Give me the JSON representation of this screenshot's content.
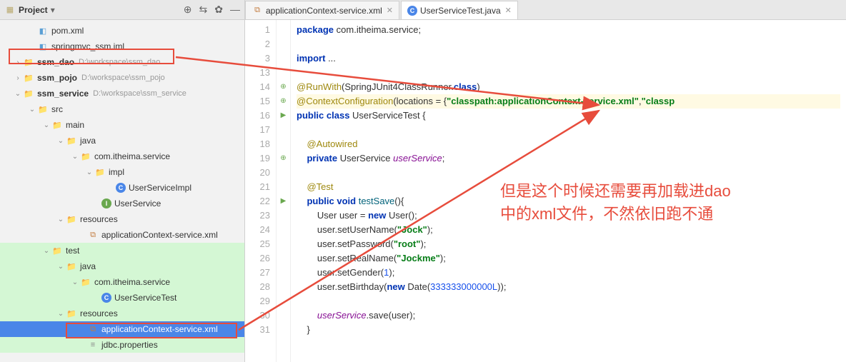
{
  "sidebar": {
    "title": "Project",
    "items": [
      {
        "indent": 38,
        "icon": "module",
        "label": "pom.xml"
      },
      {
        "indent": 38,
        "icon": "module",
        "label": "springmvc_ssm.iml"
      },
      {
        "indent": 18,
        "chev": "›",
        "icon": "folder",
        "label": "ssm_dao",
        "bold": true,
        "hint": "D:\\workspace\\ssm_dao"
      },
      {
        "indent": 18,
        "chev": "›",
        "icon": "folder",
        "label": "ssm_pojo",
        "bold": true,
        "hint": "D:\\workspace\\ssm_pojo"
      },
      {
        "indent": 18,
        "chev": "⌄",
        "icon": "folder",
        "label": "ssm_service",
        "bold": true,
        "hint": "D:\\workspace\\ssm_service"
      },
      {
        "indent": 38,
        "chev": "⌄",
        "icon": "folder",
        "label": "src"
      },
      {
        "indent": 58,
        "chev": "⌄",
        "icon": "folder",
        "label": "main"
      },
      {
        "indent": 78,
        "chev": "⌄",
        "icon": "folder-blue",
        "label": "java"
      },
      {
        "indent": 98,
        "chev": "⌄",
        "icon": "folder",
        "label": "com.itheima.service"
      },
      {
        "indent": 118,
        "chev": "⌄",
        "icon": "folder",
        "label": "impl"
      },
      {
        "indent": 148,
        "icon": "class-c",
        "iconText": "C",
        "label": "UserServiceImpl"
      },
      {
        "indent": 128,
        "icon": "class-i",
        "iconText": "I",
        "label": "UserService"
      },
      {
        "indent": 78,
        "chev": "⌄",
        "icon": "folder",
        "label": "resources"
      },
      {
        "indent": 108,
        "icon": "xml",
        "label": "applicationContext-service.xml"
      },
      {
        "indent": 58,
        "chev": "⌄",
        "icon": "folder",
        "label": "test",
        "test": true
      },
      {
        "indent": 78,
        "chev": "⌄",
        "icon": "folder-green",
        "label": "java",
        "test": true
      },
      {
        "indent": 98,
        "chev": "⌄",
        "icon": "folder",
        "label": "com.itheima.service",
        "test": true
      },
      {
        "indent": 128,
        "icon": "class-c",
        "iconText": "C",
        "label": "UserServiceTest",
        "test": true
      },
      {
        "indent": 78,
        "chev": "⌄",
        "icon": "folder",
        "label": "resources",
        "test": true
      },
      {
        "indent": 108,
        "icon": "xml",
        "label": "applicationContext-service.xml",
        "test": true,
        "selected": true
      },
      {
        "indent": 108,
        "icon": "props",
        "label": "jdbc.properties",
        "test": true
      }
    ]
  },
  "tabs": [
    {
      "icon": "xml",
      "label": "applicationContext-service.xml",
      "active": false
    },
    {
      "icon": "class-c",
      "iconText": "C",
      "label": "UserServiceTest.java",
      "active": true
    }
  ],
  "code": {
    "lines": [
      {
        "n": 1,
        "html": "<span class='kw'>package</span> com.itheima.service;"
      },
      {
        "n": 2,
        "html": ""
      },
      {
        "n": 3,
        "html": "<span class='kw'>import</span> ..."
      },
      {
        "n": 13,
        "html": ""
      },
      {
        "n": 14,
        "marker": "⊕",
        "html": "<span class='ann'>@RunWith</span>(SpringJUnit4ClassRunner.<span class='kw'>class</span>)"
      },
      {
        "n": 15,
        "marker": "⊕",
        "hl": true,
        "html": "<span class='ann'>@ContextConfiguration</span>(locations = {<span class='str'>\"classpath:applicationContext-service.xml\"</span>,<span class='str'>\"classp</span>"
      },
      {
        "n": 16,
        "marker": "▶",
        "html": "<span class='kw'>public class</span> UserServiceTest {"
      },
      {
        "n": 17,
        "html": ""
      },
      {
        "n": 18,
        "html": "    <span class='ann'>@Autowired</span>"
      },
      {
        "n": 19,
        "marker": "⊕",
        "html": "    <span class='kw'>private</span> UserService <span class='id'>userService</span>;"
      },
      {
        "n": 20,
        "html": ""
      },
      {
        "n": 21,
        "html": "    <span class='ann'>@Test</span>"
      },
      {
        "n": 22,
        "marker": "▶",
        "html": "    <span class='kw'>public void</span> <span class='mth'>testSave</span>(){"
      },
      {
        "n": 23,
        "html": "        User user = <span class='kw'>new</span> User();"
      },
      {
        "n": 24,
        "html": "        user.setUserName(<span class='str'>\"Jock\"</span>);"
      },
      {
        "n": 25,
        "html": "        user.setPassword(<span class='str'>\"root\"</span>);"
      },
      {
        "n": 26,
        "html": "        user.setRealName(<span class='str'>\"Jockme\"</span>);"
      },
      {
        "n": 27,
        "html": "        user.setGender(<span class='num'>1</span>);"
      },
      {
        "n": 28,
        "html": "        user.setBirthday(<span class='kw'>new</span> Date(<span class='num'>333333000000L</span>));"
      },
      {
        "n": 29,
        "html": ""
      },
      {
        "n": 30,
        "html": "        <span class='id'>userService</span>.save(user);"
      },
      {
        "n": 31,
        "html": "    }"
      }
    ]
  },
  "annotation": {
    "line1": "但是这个时候还需要再加载进dao",
    "line2": "中的xml文件，不然依旧跑不通"
  }
}
